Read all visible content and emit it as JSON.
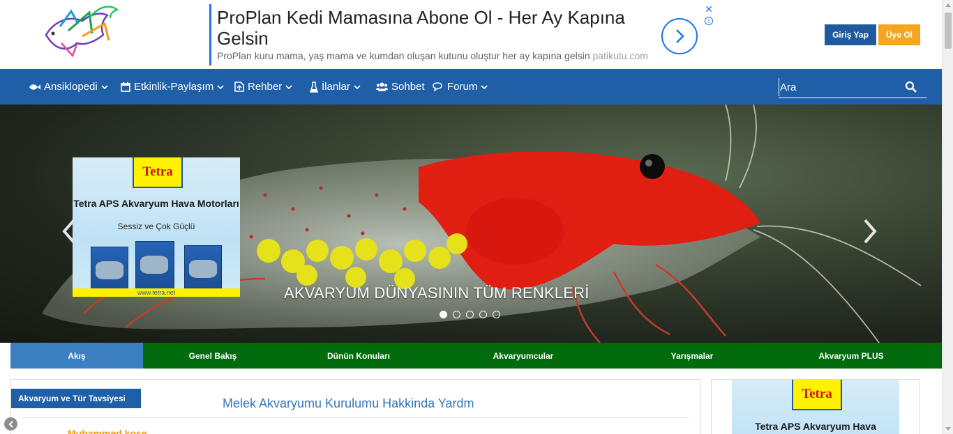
{
  "header": {
    "logo_alt": "akvaryum logo",
    "login_label": "Giriş Yap",
    "signup_label": "Üye Ol"
  },
  "top_ad": {
    "title": "ProPlan Kedi Mamasına Abone Ol - Her Ay Kapına Gelsin",
    "description": "ProPlan kuru mama, yaş mama ve kumdan oluşan kutunu oluştur her ay kapına gelsin",
    "domain": "patikutu.com",
    "close_symbol": "✕",
    "info_symbol": "i"
  },
  "nav": {
    "items": [
      {
        "label": "Ansiklopedi",
        "icon": "fish-icon",
        "dropdown": true
      },
      {
        "label": "Etkinlik-Paylaşım",
        "icon": "calendar-icon",
        "dropdown": true
      },
      {
        "label": "Rehber",
        "icon": "guide-icon",
        "dropdown": true
      },
      {
        "label": "İlanlar",
        "icon": "flask-icon",
        "dropdown": true
      },
      {
        "label": "Sohbet",
        "icon": "users-icon",
        "dropdown": false
      },
      {
        "label": "Forum",
        "icon": "comments-icon",
        "dropdown": true
      }
    ],
    "search_placeholder": "Ara"
  },
  "hero": {
    "caption": "AKVARYUM DÜNYASININ TÜM RENKLERİ",
    "slide_count": 5,
    "active_slide": 1
  },
  "left_ad": {
    "brand": "Tetra",
    "line1": "Tetra APS Akvaryum Hava Motorları",
    "line2": "Sessiz ve Çok Güçlü",
    "footer": "www.tetra.net"
  },
  "tabs": [
    {
      "label": "Akış",
      "active": true
    },
    {
      "label": "Genel Bakış",
      "active": false
    },
    {
      "label": "Dünün Konuları",
      "active": false
    },
    {
      "label": "Akvaryumcular",
      "active": false
    },
    {
      "label": "Yarışmalar",
      "active": false
    },
    {
      "label": "Akvaryum PLUS",
      "active": false
    }
  ],
  "content": {
    "category": "Akvaryum ve Tür Tavsiyesi",
    "post_title": "Melek Akvaryumu Kurulumu Hakkinda Yardm",
    "author": "Muhammed kose"
  },
  "right_ad": {
    "brand": "Tetra",
    "line1": "Tetra APS Akvaryum Hava"
  },
  "colors": {
    "nav_bg": "#1f5fa7",
    "tabs_bg": "#016b0e",
    "active_tab": "#3b7fc0",
    "login_btn": "#1f5a9e",
    "signup_btn": "#f4a623",
    "link": "#3477ba",
    "author": "#f39c12"
  }
}
